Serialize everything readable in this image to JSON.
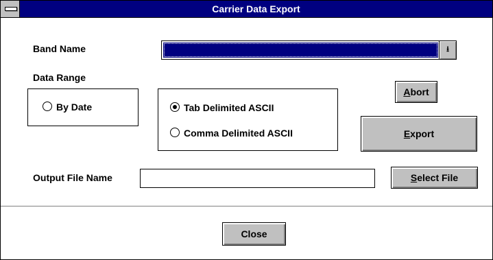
{
  "window": {
    "title": "Carrier Data Export"
  },
  "band": {
    "label": "Band Name",
    "selected_value": ""
  },
  "data_range": {
    "label": "Data Range",
    "by_date_option": "By Date",
    "format_options": [
      "Tab Delimited ASCII",
      "Comma Delimited ASCII"
    ],
    "selected_format": "Tab Delimited ASCII"
  },
  "buttons": {
    "abort_mnemonic": "A",
    "abort_rest": "bort",
    "export_mnemonic": "E",
    "export_rest": "xport",
    "select_file_mnemonic": "S",
    "select_file_rest": "elect File",
    "close": "Close"
  },
  "output": {
    "label": "Output File Name",
    "value": ""
  },
  "colors": {
    "titlebar": "#000080",
    "button_face": "#c0c0c0",
    "selection": "#000080"
  }
}
